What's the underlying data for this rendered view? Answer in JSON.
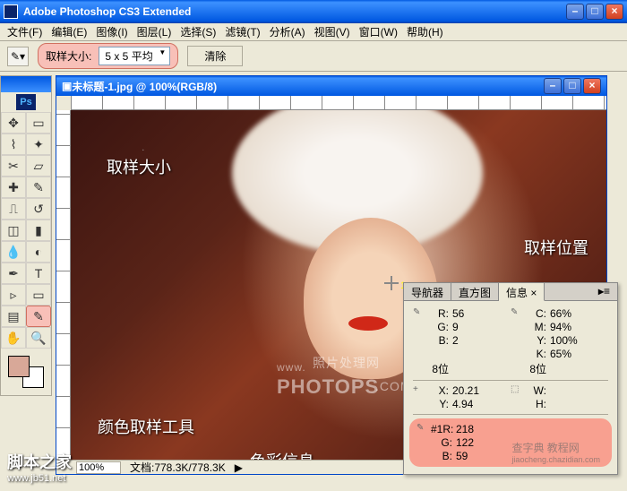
{
  "app": {
    "title": "Adobe Photoshop CS3 Extended"
  },
  "menu": {
    "items": [
      "文件(F)",
      "编辑(E)",
      "图像(I)",
      "图层(L)",
      "选择(S)",
      "滤镜(T)",
      "分析(A)",
      "视图(V)",
      "窗口(W)",
      "帮助(H)"
    ]
  },
  "optbar": {
    "sample_label": "取样大小:",
    "sample_value": "5 x 5 平均",
    "clear": "清除"
  },
  "doc": {
    "title": "未标题-1.jpg @ 100%(RGB/8)"
  },
  "annotations": {
    "sample_size": "取样大小",
    "sample_pos": "取样位置",
    "color_tool": "颜色取样工具",
    "color_info": "色彩信息"
  },
  "watermark": {
    "line1": "www.",
    "line2": "PHOTOPS",
    "line3": "照片处理网",
    "line4": ".COM"
  },
  "status": {
    "zoom": "100%",
    "docsize": "文档:778.3K/778.3K"
  },
  "info_panel": {
    "tabs": {
      "nav": "导航器",
      "hist": "直方图",
      "info": "信息"
    },
    "rgb": {
      "r_label": "R:",
      "r": "56",
      "g_label": "G:",
      "g": "9",
      "b_label": "B:",
      "b": "2"
    },
    "cmyk": {
      "c_label": "C:",
      "c": "66%",
      "m_label": "M:",
      "m": "94%",
      "y_label": "Y:",
      "y": "100%",
      "k_label": "K:",
      "k": "65%"
    },
    "bits": "8位",
    "xy": {
      "x_label": "X:",
      "x": "20.21",
      "y_label": "Y:",
      "y": "4.94"
    },
    "wh": {
      "w_label": "W:",
      "h_label": "H:"
    },
    "sample1": {
      "label": "#1R:",
      "r": "218",
      "g_label": "G:",
      "g": "122",
      "b_label": "B:",
      "b": "59"
    }
  },
  "site": {
    "name": "脚本之家",
    "url": "www.jb51.net",
    "other": "查字典  教程网",
    "other_url": "jiaocheng.chazidian.com"
  }
}
